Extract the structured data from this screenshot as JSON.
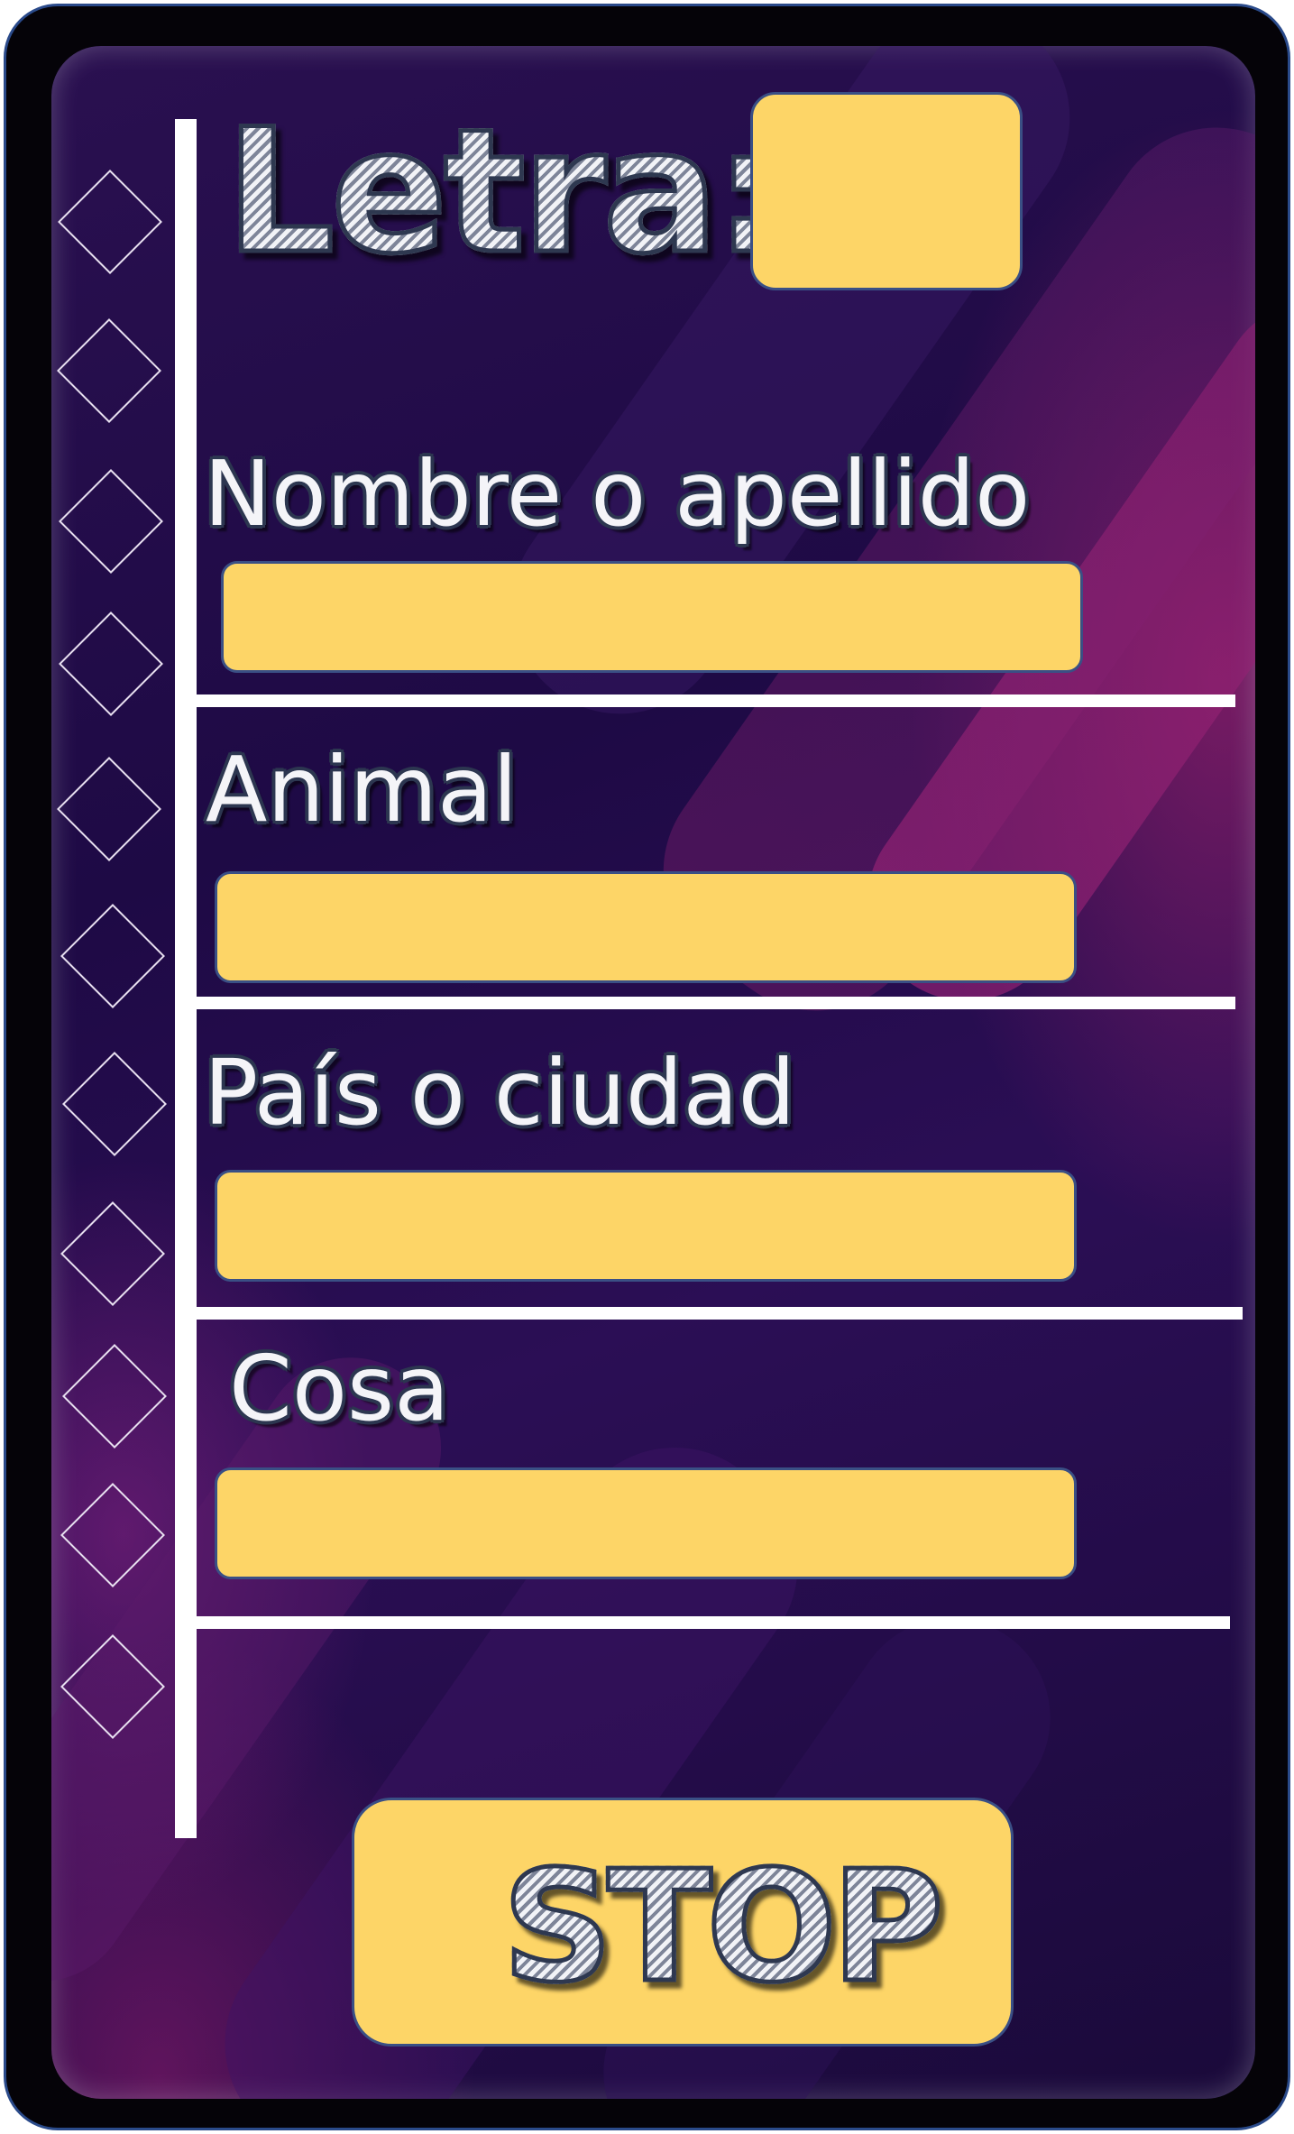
{
  "header": {
    "letter_label": "Letra:"
  },
  "fields": [
    {
      "label": "Nombre o apellido"
    },
    {
      "label": "Animal"
    },
    {
      "label": "País o ciudad"
    },
    {
      "label": "Cosa"
    }
  ],
  "stop_button": {
    "label": "STOP"
  },
  "colors": {
    "accent": "#fdd567",
    "background": "#1e0a45",
    "outline": "#3a4f85",
    "frame": "#050308"
  }
}
